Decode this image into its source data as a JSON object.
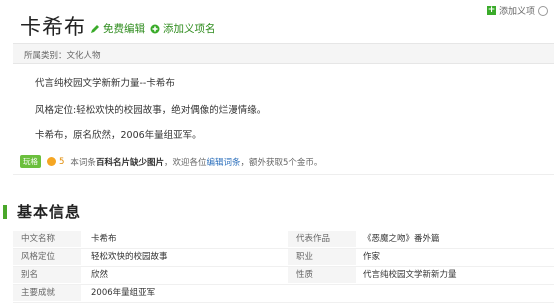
{
  "header": {
    "title": "卡希布",
    "edit_label": "免费编辑",
    "add_semantic_label": "添加义项名",
    "top_right_label": "添加义项"
  },
  "category": {
    "text": "所属类别：文化人物"
  },
  "intro": {
    "p1": "代言纯校园文学新新力量--卡希布",
    "p2": "风格定位:轻松欢快的校园故事，绝对偶像的烂漫情缘。",
    "p3": "卡希布，原名欣然，2006年量组亚军。"
  },
  "notice": {
    "badge": "玩格",
    "coin_count": "5",
    "text_before": "本词条",
    "bold_text": "百科名片缺少图片",
    "text_middle": "，欢迎各位",
    "link_text": "编辑词条",
    "text_after": "，额外获取5个金币。"
  },
  "basic_info": {
    "title": "基本信息",
    "rows": [
      {
        "k1": "中文名称",
        "v1": "卡希布",
        "k2": "代表作品",
        "v2": "《恶魔之吻》番外篇"
      },
      {
        "k1": "风格定位",
        "v1": "轻松欢快的校园故事",
        "k2": "职业",
        "v2": "作家"
      },
      {
        "k1": "别名",
        "v1": "欣然",
        "k2": "性质",
        "v2": "代言纯校园文学新新力量"
      },
      {
        "k1": "主要成就",
        "v1": "2006年量组亚军",
        "k2": "",
        "v2": ""
      }
    ]
  },
  "colors": {
    "accent": "#4aa72a",
    "link": "#2a6ebb",
    "coin": "#f5a623"
  }
}
